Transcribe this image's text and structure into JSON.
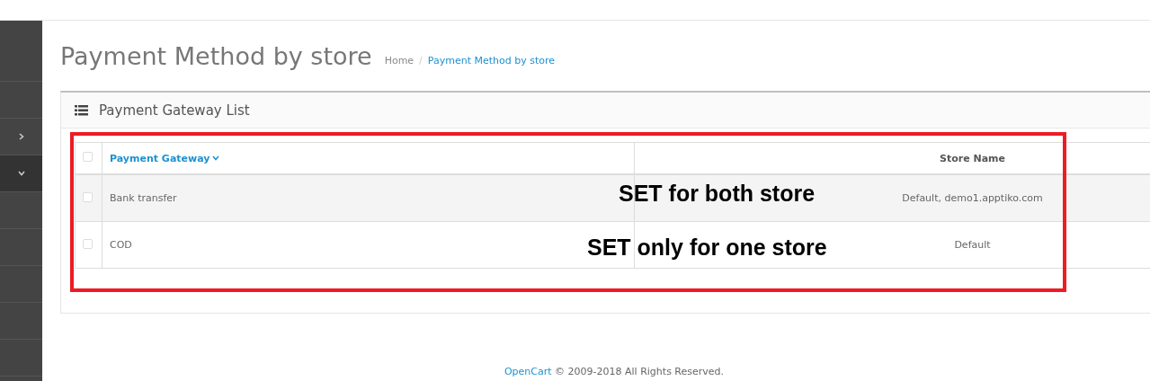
{
  "sidebar": {
    "items": [
      {
        "kind": "plain",
        "expanded": false
      },
      {
        "kind": "plain",
        "expanded": false
      },
      {
        "kind": "toggle",
        "expanded": false
      },
      {
        "kind": "toggle",
        "expanded": true
      },
      {
        "kind": "plain",
        "expanded": false
      },
      {
        "kind": "plain",
        "expanded": false
      },
      {
        "kind": "plain",
        "expanded": false
      },
      {
        "kind": "plain",
        "expanded": false
      },
      {
        "kind": "plain",
        "expanded": false
      }
    ]
  },
  "page": {
    "title": "Payment Method by store",
    "breadcrumb_separator": "/",
    "breadcrumb": [
      {
        "label": "Home",
        "selected": false
      },
      {
        "label": "Payment Method by store",
        "selected": true
      }
    ]
  },
  "panel": {
    "title": "Payment Gateway List"
  },
  "table": {
    "columns": [
      {
        "label": "Payment Gateway",
        "sorted": true
      },
      {
        "label": "Store Name",
        "sorted": false
      }
    ],
    "select_all": {
      "checked": false
    },
    "rows": [
      {
        "gateway": "Bank transfer",
        "store": "Default, demo1.apptiko.com",
        "checked": false
      },
      {
        "gateway": "COD",
        "store": "Default",
        "checked": false
      }
    ]
  },
  "annotations": [
    "SET for both store",
    "SET only for one store"
  ],
  "footer": {
    "link": "OpenCart",
    "text": "© 2009-2018 All Rights Reserved."
  }
}
